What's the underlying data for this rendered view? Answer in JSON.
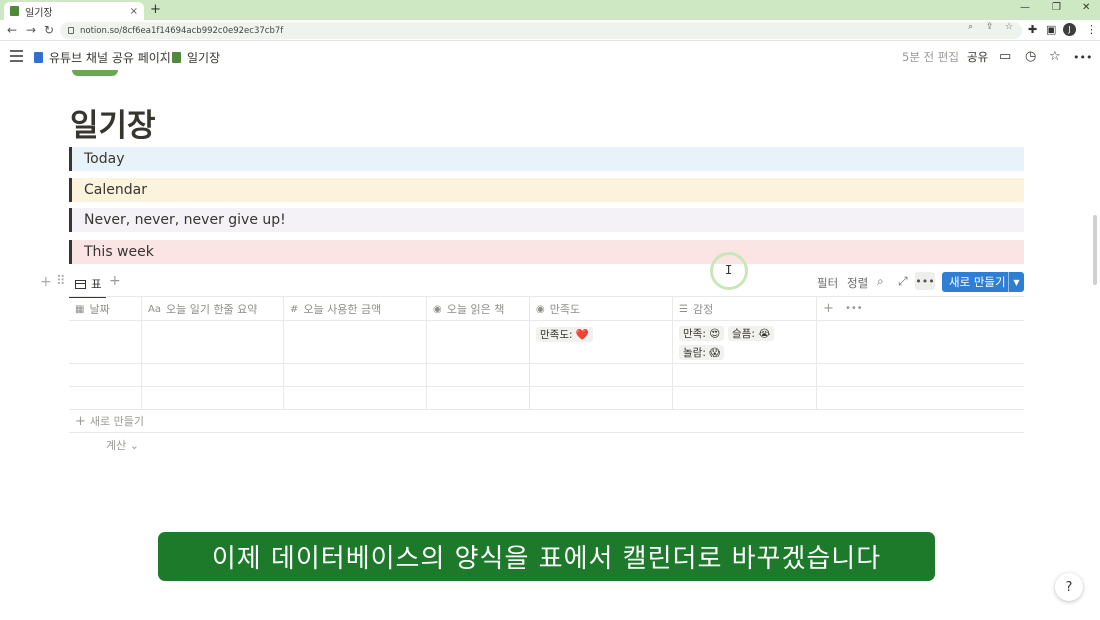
{
  "browser": {
    "tab_title": "일기장",
    "tab_close": "×",
    "new_tab": "+",
    "url": "notion.so/8cf6ea1f14694acb992c0e92ec37cb7f",
    "profile_initial": "J",
    "window_controls": [
      "—",
      "❐",
      "✕"
    ]
  },
  "topbar": {
    "breadcrumb": [
      {
        "label": "유튜브 채널 공유 페이지",
        "color": "#2f6fd0"
      },
      {
        "label": "일기장",
        "color": "#4f8a3c"
      }
    ],
    "separator": "/",
    "edited": "5분 전 편집",
    "share": "공유",
    "more": "•••"
  },
  "page": {
    "title": "일기장",
    "callouts": [
      {
        "label": "Today",
        "bg": "#e7f3f8"
      },
      {
        "label": "Calendar",
        "bg": "#fbf3db"
      },
      {
        "label": "Never, never, never give up!",
        "bg": "#f4f1f7"
      },
      {
        "label": "This week",
        "bg": "#fbe4e4"
      }
    ]
  },
  "database": {
    "view_tab": "표",
    "filter": "필터",
    "sort": "정렬",
    "more": "•••",
    "new_button": "새로 만들기",
    "columns": [
      {
        "icon": "▦",
        "label": "날짜"
      },
      {
        "icon": "Aa",
        "label": "오늘 일기 한줄 요약"
      },
      {
        "icon": "#",
        "label": "오늘 사용한 금액"
      },
      {
        "icon": "◉",
        "label": "오늘 읽은 책"
      },
      {
        "icon": "◉",
        "label": "만족도"
      },
      {
        "icon": "☰",
        "label": "감정"
      }
    ],
    "add_column": "+",
    "column_more": "•••",
    "rows": [
      {
        "satisfaction": "만족도: ❤️",
        "emotions": [
          "만족: 😍",
          "슬픔: 😭",
          "놀람: 😱"
        ]
      },
      {
        "satisfaction": "",
        "emotions": []
      },
      {
        "satisfaction": "",
        "emotions": []
      }
    ],
    "add_row": "새로 만들기",
    "calculate": "계산 ⌄"
  },
  "subtitle": "이제 데이터베이스의 양식을 표에서 캘린더로 바꾸겠습니다",
  "help": "?"
}
